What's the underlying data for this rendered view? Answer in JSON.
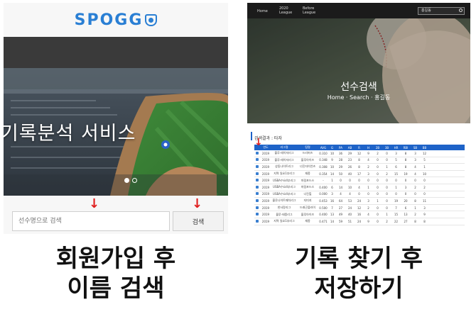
{
  "left": {
    "logo": "SPOGG",
    "hero_title": "기록분석 서비스",
    "search_placeholder": "선수명으로 검색",
    "search_button": "검색",
    "caption_line1": "회원가입 후",
    "caption_line2": "이름 검색"
  },
  "right": {
    "nav": [
      "Home",
      "2020\nLeague",
      "Before\nLeague"
    ],
    "top_search_value": "홍길동",
    "page_title": "선수검색",
    "breadcrumb": "Home · Search · 홍길동",
    "result_label": "검색결과 : 타자",
    "table_headers": [
      "",
      "연도",
      "리그명",
      "팀명",
      "AVG",
      "G",
      "PA",
      "AB",
      "R",
      "H",
      "2B",
      "3B",
      "HR",
      "RBI",
      "SB",
      "BB"
    ],
    "table_rows": [
      [
        "2019",
        "블루·레이저리그",
        "드리머즈",
        "0.310",
        "10",
        "36",
        "29",
        "12",
        "9",
        "2",
        "0",
        "3",
        "8",
        "3",
        "12"
      ],
      [
        "2019",
        "블루·레이저리그",
        "블루아이즈",
        "0.348",
        "9",
        "28",
        "23",
        "8",
        "4",
        "0",
        "0",
        "5",
        "8",
        "3",
        "5"
      ],
      [
        "2019",
        "상동나이트리그",
        "너진자이언츠",
        "0.308",
        "10",
        "29",
        "26",
        "8",
        "2",
        "0",
        "1",
        "6",
        "8",
        "4",
        "1"
      ],
      [
        "2019",
        "지역 일요1부리그",
        "재종",
        "0.354",
        "14",
        "50",
        "40",
        "17",
        "3",
        "0",
        "2",
        "15",
        "19",
        "4",
        "10"
      ],
      [
        "2019",
        "USBA수요4부리그",
        "마림포드스",
        "-",
        "1",
        "0",
        "0",
        "0",
        "0",
        "0",
        "0",
        "0",
        "0",
        "0",
        "0"
      ],
      [
        "2019",
        "USBA수요4부리그",
        "마림포드스",
        "0.400",
        "6",
        "14",
        "10",
        "4",
        "1",
        "0",
        "0",
        "1",
        "3",
        "2",
        "2"
      ],
      [
        "2019",
        "USBA수요4부리그",
        "너진힐",
        "0.000",
        "3",
        "4",
        "4",
        "0",
        "0",
        "0",
        "0",
        "0",
        "0",
        "0",
        "0"
      ],
      [
        "2019",
        "블루나이트패치리그",
        "지미지",
        "0.453",
        "16",
        "64",
        "53",
        "24",
        "3",
        "1",
        "0",
        "19",
        "20",
        "8",
        "11"
      ],
      [
        "2019",
        "한사랑리그",
        "드래곤플라이",
        "0.500",
        "7",
        "27",
        "24",
        "12",
        "2",
        "0",
        "0",
        "7",
        "6",
        "1",
        "3"
      ],
      [
        "2019",
        "블루·태풍리그",
        "블루아이즈",
        "0.400",
        "13",
        "49",
        "40",
        "16",
        "4",
        "0",
        "1",
        "15",
        "13",
        "2",
        "9"
      ],
      [
        "2019",
        "지역 일요1부리그",
        "재종",
        "0.471",
        "14",
        "59",
        "51",
        "24",
        "9",
        "0",
        "2",
        "22",
        "27",
        "8",
        "8"
      ]
    ],
    "caption_line1": "기록 찾기 후",
    "caption_line2": "저장하기"
  }
}
